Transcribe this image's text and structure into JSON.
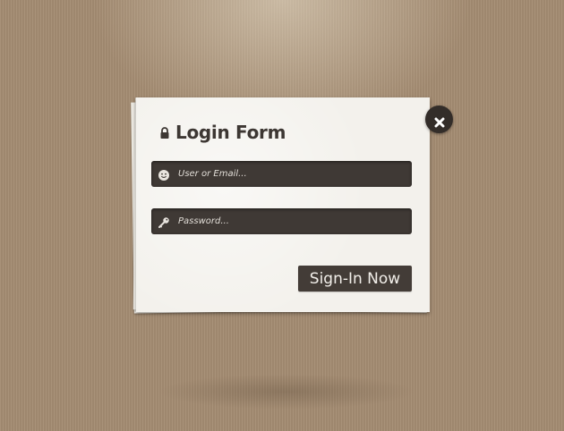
{
  "login_form": {
    "title": "Login Form",
    "username": {
      "placeholder": "User or Email...",
      "value": "",
      "icon": "smiley-icon"
    },
    "password": {
      "placeholder": "Password...",
      "value": "",
      "icon": "key-icon"
    },
    "submit_label": "Sign-In Now",
    "close_icon": "close-icon",
    "title_icon": "lock-icon"
  },
  "colors": {
    "background": "#a48c72",
    "card": "#f3f1ec",
    "field": "#3f3935",
    "button": "#433c37",
    "title_text": "#3d3733",
    "close_button": "#332d29"
  }
}
